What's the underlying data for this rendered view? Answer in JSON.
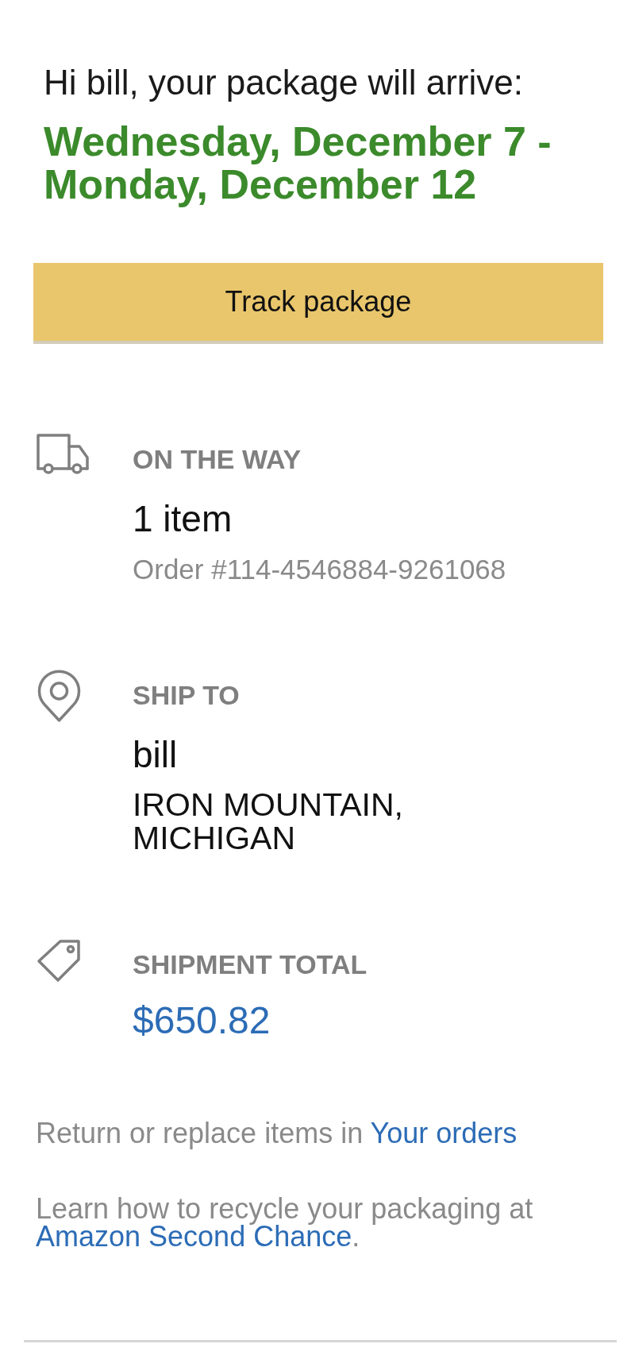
{
  "greeting": "Hi bill, your package will arrive:",
  "delivery_window": "Wednesday, December 7 - Monday, December 12",
  "track_button": {
    "label": "Track package"
  },
  "sections": [
    {
      "kind": "shipment",
      "heading": "ON THE WAY",
      "lines": [
        {
          "kind": "count",
          "text": "1 item"
        },
        {
          "kind": "order",
          "text": "Order #114-4546884-9261068"
        }
      ]
    },
    {
      "kind": "ship_to",
      "heading": "SHIP TO",
      "lines": [
        {
          "kind": "name",
          "text": "bill"
        },
        {
          "kind": "address",
          "text": "IRON MOUNTAIN, MICHIGAN"
        }
      ]
    },
    {
      "kind": "total",
      "heading": "SHIPMENT TOTAL",
      "lines": [
        {
          "kind": "amount",
          "text": "$650.82"
        }
      ]
    }
  ],
  "notes": [
    {
      "text": "Return or replace items in",
      "link": "Your orders"
    },
    {
      "text": "Learn how to recycle your packaging at",
      "link": "Amazon Second Chance",
      "after": "."
    }
  ]
}
